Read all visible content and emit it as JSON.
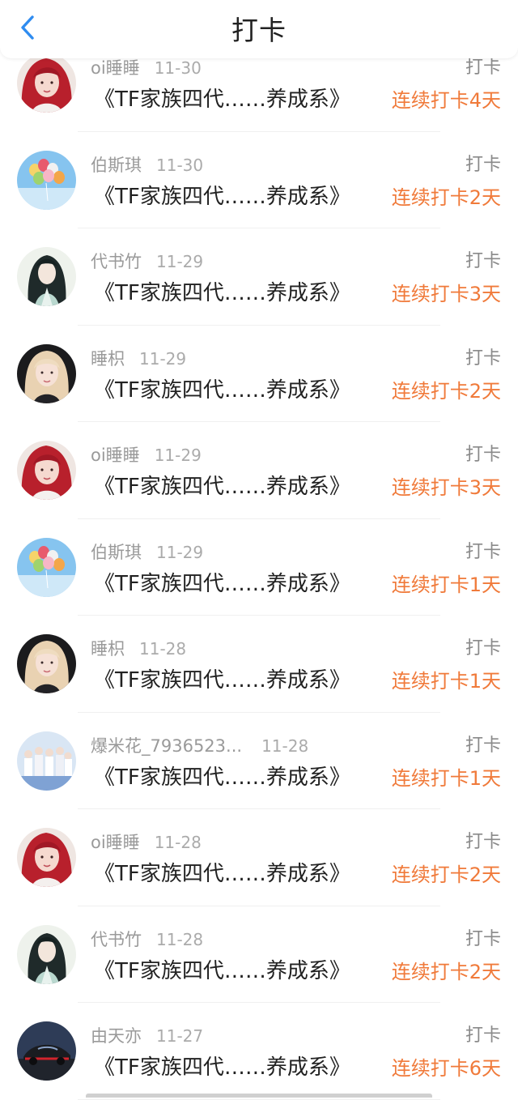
{
  "header": {
    "title": "打卡",
    "back_icon": "chevron-left-icon",
    "accent_color": "#2f8cf0"
  },
  "colors": {
    "streak": "#f07a3a",
    "meta": "#9a9a9a",
    "text": "#222222"
  },
  "items": [
    {
      "user": "oi睡睡",
      "date": "11-30",
      "tag": "打卡",
      "circle": "《TF家族四代……养成系》",
      "streak": "连续打卡4天",
      "avatar": "red-hair-girl"
    },
    {
      "user": "伯斯琪",
      "date": "11-30",
      "tag": "打卡",
      "circle": "《TF家族四代……养成系》",
      "streak": "连续打卡2天",
      "avatar": "balloons"
    },
    {
      "user": "代书竹",
      "date": "11-29",
      "tag": "打卡",
      "circle": "《TF家族四代……养成系》",
      "streak": "连续打卡3天",
      "avatar": "anime-man"
    },
    {
      "user": "睡枳",
      "date": "11-29",
      "tag": "打卡",
      "circle": "《TF家族四代……养成系》",
      "streak": "连续打卡2天",
      "avatar": "blonde-girl"
    },
    {
      "user": "oi睡睡",
      "date": "11-29",
      "tag": "打卡",
      "circle": "《TF家族四代……养成系》",
      "streak": "连续打卡3天",
      "avatar": "red-hair-girl"
    },
    {
      "user": "伯斯琪",
      "date": "11-29",
      "tag": "打卡",
      "circle": "《TF家族四代……养成系》",
      "streak": "连续打卡1天",
      "avatar": "balloons"
    },
    {
      "user": "睡枳",
      "date": "11-28",
      "tag": "打卡",
      "circle": "《TF家族四代……养成系》",
      "streak": "连续打卡1天",
      "avatar": "blonde-girl"
    },
    {
      "user": "爆米花_7936523...",
      "date": "11-28",
      "tag": "打卡",
      "circle": "《TF家族四代……养成系》",
      "streak": "连续打卡1天",
      "avatar": "group-photo"
    },
    {
      "user": "oi睡睡",
      "date": "11-28",
      "tag": "打卡",
      "circle": "《TF家族四代……养成系》",
      "streak": "连续打卡2天",
      "avatar": "red-hair-girl"
    },
    {
      "user": "代书竹",
      "date": "11-28",
      "tag": "打卡",
      "circle": "《TF家族四代……养成系》",
      "streak": "连续打卡2天",
      "avatar": "anime-man"
    },
    {
      "user": "由天亦",
      "date": "11-27",
      "tag": "打卡",
      "circle": "《TF家族四代……养成系》",
      "streak": "连续打卡6天",
      "avatar": "sports-car"
    }
  ]
}
